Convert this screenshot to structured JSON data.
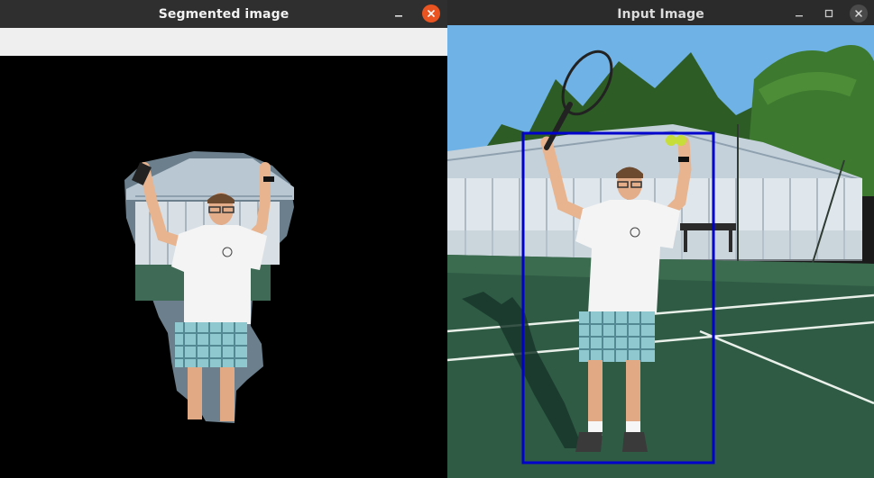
{
  "windows": {
    "segmented": {
      "title": "Segmented image",
      "controls": [
        "minimize-icon",
        "close-icon"
      ]
    },
    "input": {
      "title": "Input Image",
      "controls": [
        "minimize-icon",
        "maximize-icon",
        "close-icon"
      ]
    }
  },
  "colors": {
    "close_active": "#e95420",
    "bounding_box": "#0000cc",
    "court": "#2f5b45",
    "sky": "#6fb2e6"
  }
}
